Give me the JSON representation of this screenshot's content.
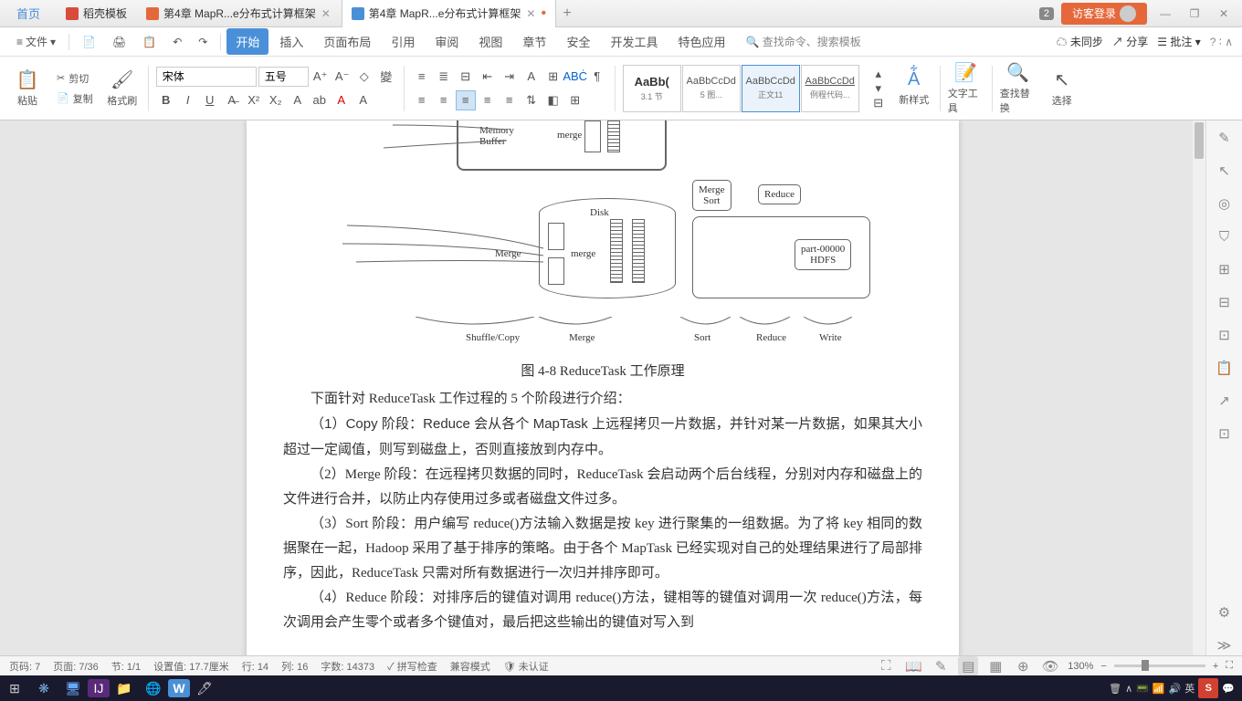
{
  "tabs": {
    "home": "首页",
    "t1": "稻壳模板",
    "t2": "第4章 MapR...e分布式计算框架",
    "t3": "第4章 MapR...e分布式计算框架"
  },
  "top_right": {
    "badge": "2",
    "login": "访客登录"
  },
  "menu": {
    "file": "文件",
    "items": [
      "开始",
      "插入",
      "页面布局",
      "引用",
      "审阅",
      "视图",
      "章节",
      "安全",
      "开发工具",
      "特色应用"
    ],
    "search": "查找命令、搜索模板",
    "unsync": "未同步",
    "share": "分享",
    "annotate": "批注"
  },
  "ribbon": {
    "paste": "粘贴",
    "cut": "剪切",
    "copy": "复制",
    "format": "格式刷",
    "font_name": "宋体",
    "font_size": "五号",
    "styles": [
      {
        "preview": "AaBb(",
        "name": "3.1 节"
      },
      {
        "preview": "AaBbCcDd",
        "name": "5 图..."
      },
      {
        "preview": "AaBbCcDd",
        "name": "正文11"
      },
      {
        "preview": "AaBbCcDd",
        "name": "例程代码..."
      }
    ],
    "new_style": "新样式",
    "text_tool": "文字工具",
    "find_replace": "查找替换",
    "select": "选择"
  },
  "doc": {
    "diag": {
      "mem_buffer": "Memory\nBuffer",
      "merge1": "merge",
      "disk": "Disk",
      "merge2": "Merge",
      "merge3": "merge",
      "merge_sort": "Merge\nSort",
      "reduce": "Reduce",
      "part": "part-00000\nHDFS",
      "lbl_sc": "Shuffle/Copy",
      "lbl_m": "Merge",
      "lbl_s": "Sort",
      "lbl_r": "Reduce",
      "lbl_w": "Write"
    },
    "caption": "图 4-8  ReduceTask 工作原理",
    "p1": "下面针对 ReduceTask 工作过程的 5 个阶段进行介绍：",
    "p2": "（1）Copy 阶段：Reduce 会从各个 MapTask 上远程拷贝一片数据，并针对某一片数据，如果其大小超过一定阈值，则写到磁盘上，否则直接放到内存中。",
    "p3": "（2）Merge 阶段：在远程拷贝数据的同时，ReduceTask 会启动两个后台线程，分别对内存和磁盘上的文件进行合并，以防止内存使用过多或者磁盘文件过多。",
    "p4": "（3）Sort 阶段：用户编写 reduce()方法输入数据是按 key 进行聚集的一组数据。为了将 key 相同的数据聚在一起，Hadoop 采用了基于排序的策略。由于各个 MapTask 已经实现对自己的处理结果进行了局部排序，因此，ReduceTask 只需对所有数据进行一次归并排序即可。",
    "p5": "（4）Reduce 阶段：对排序后的键值对调用 reduce()方法，键相等的键值对调用一次 reduce()方法，每次调用会产生零个或者多个键值对，最后把这些输出的键值对写入到"
  },
  "status": {
    "page": "页码: 7",
    "pages": "页面: 7/36",
    "sec": "节: 1/1",
    "pos": "设置值: 17.7厘米",
    "row": "行: 14",
    "col": "列: 16",
    "words": "字数: 14373",
    "spell": "拼写检查",
    "compat": "兼容模式",
    "cert": "未认证",
    "zoom": "130%"
  }
}
